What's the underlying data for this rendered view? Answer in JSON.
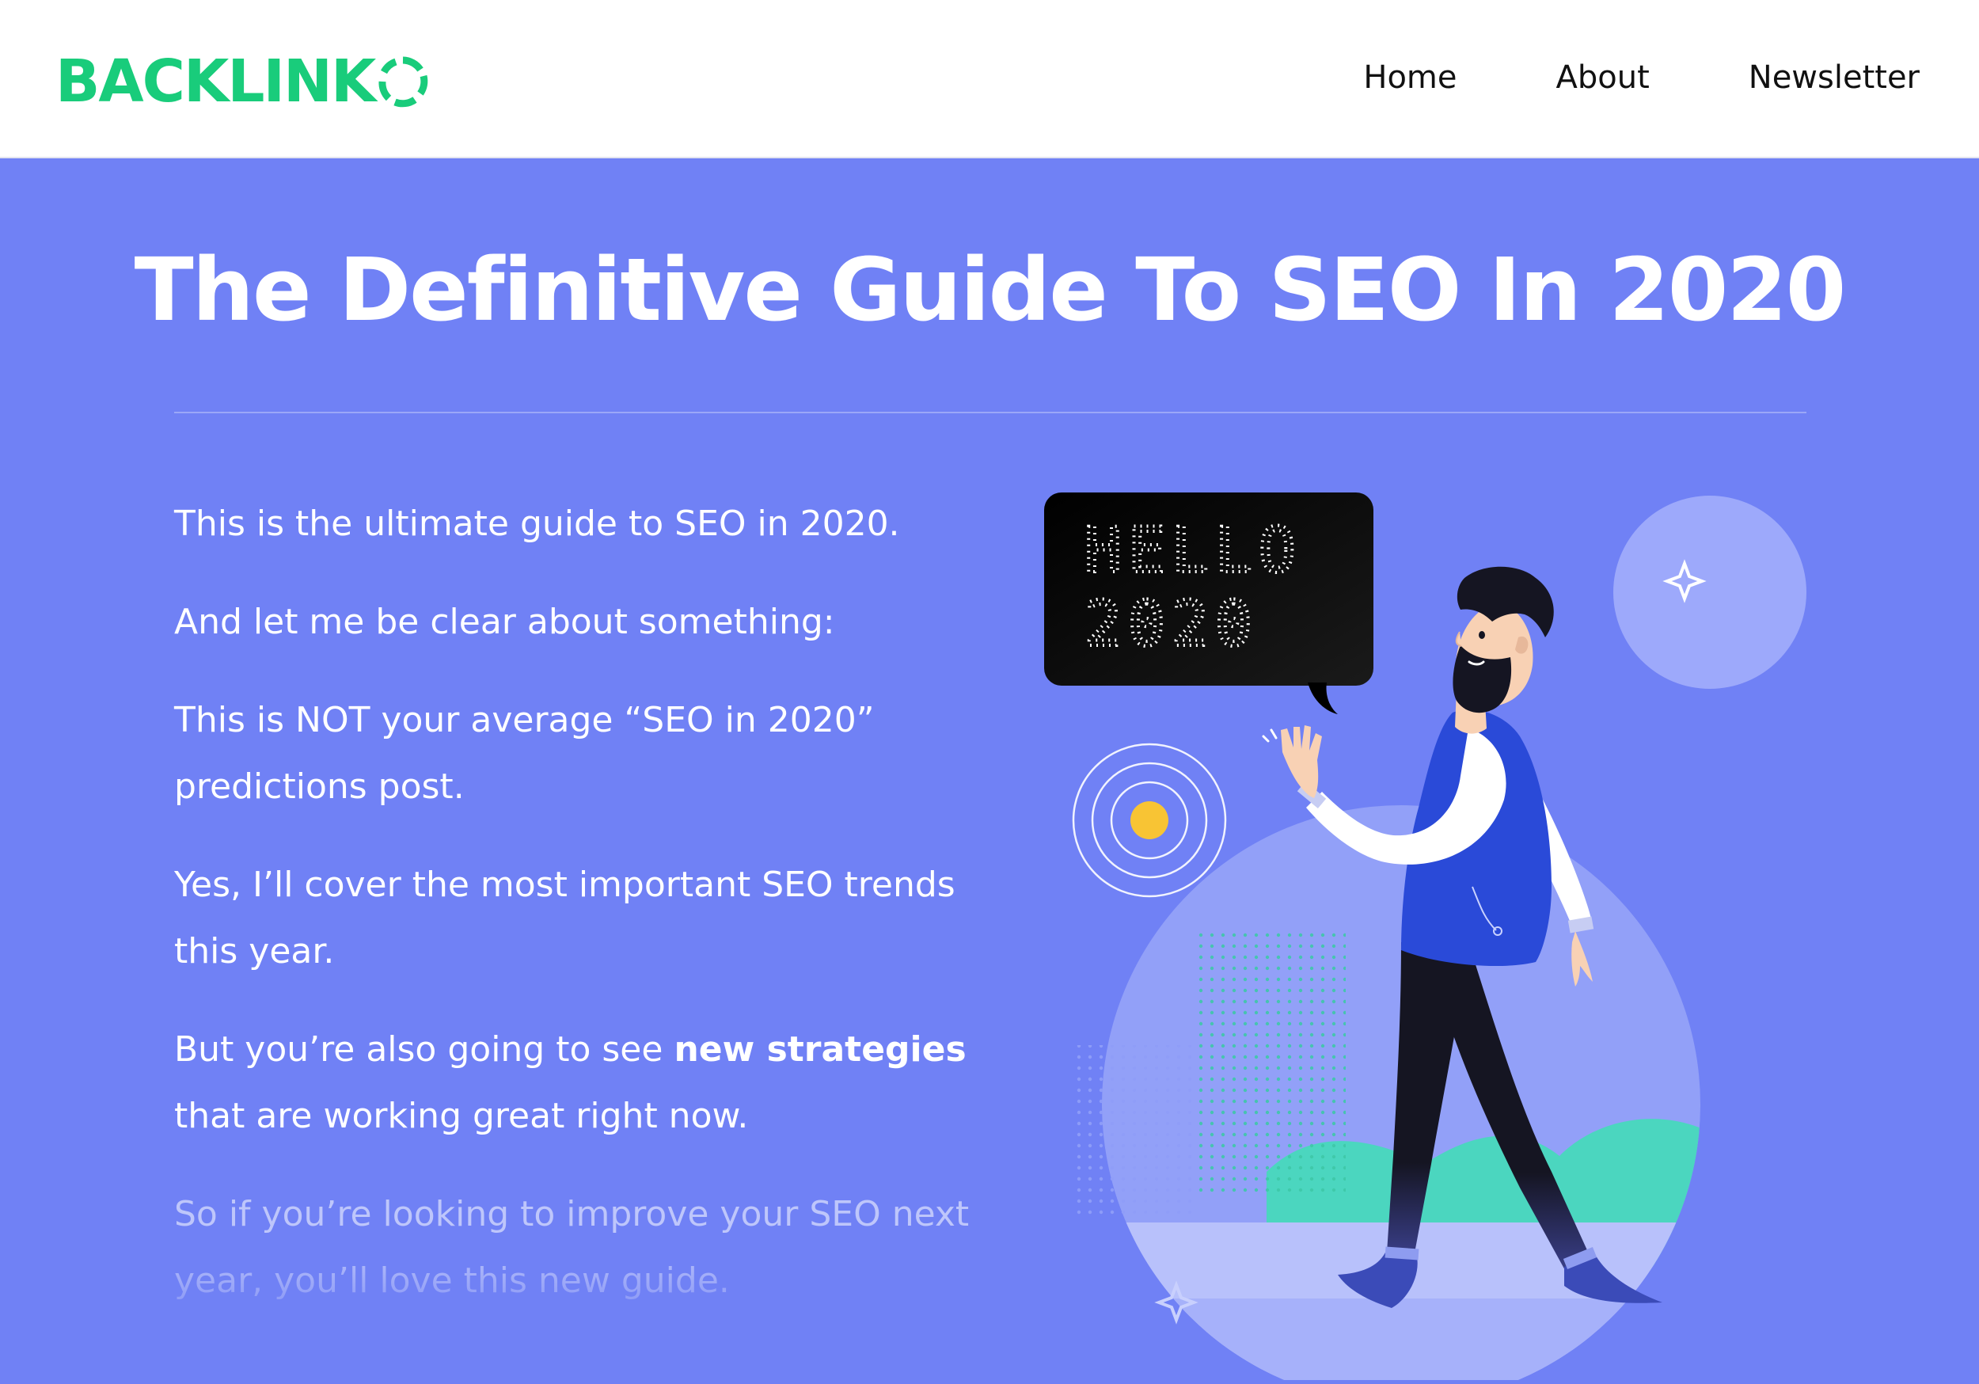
{
  "header": {
    "logo_text": "BACKLINK",
    "logo_mark": "O",
    "nav": [
      {
        "label": "Home"
      },
      {
        "label": "About"
      },
      {
        "label": "Newsletter"
      }
    ]
  },
  "hero": {
    "title": "The Definitive Guide To SEO In 2020",
    "paragraphs": [
      "This is the ultimate guide to SEO in 2020.",
      "And let me be clear about something:",
      "This is NOT your average “SEO in 2020” predictions post.",
      "Yes, I’ll cover the most important SEO trends this year.",
      {
        "before": "But you’re also going to see ",
        "bold": "new strategies",
        "after": " that are working great right now."
      },
      "So if you’re looking to improve your SEO next year, you’ll love this new guide."
    ]
  },
  "illustration": {
    "speech_bubble_lines": [
      "HELLO",
      "2020"
    ]
  },
  "colors": {
    "brand_green": "#19cc7b",
    "hero_background": "#7081f5",
    "header_background": "#ffffff",
    "accent_yellow": "#f8c434",
    "vest_blue": "#2a4ad8",
    "hill_teal": "#4bd6bf"
  },
  "icons": [
    "logo-o-icon",
    "sparkle-icon",
    "radar-target-icon",
    "speech-bubble-icon"
  ]
}
